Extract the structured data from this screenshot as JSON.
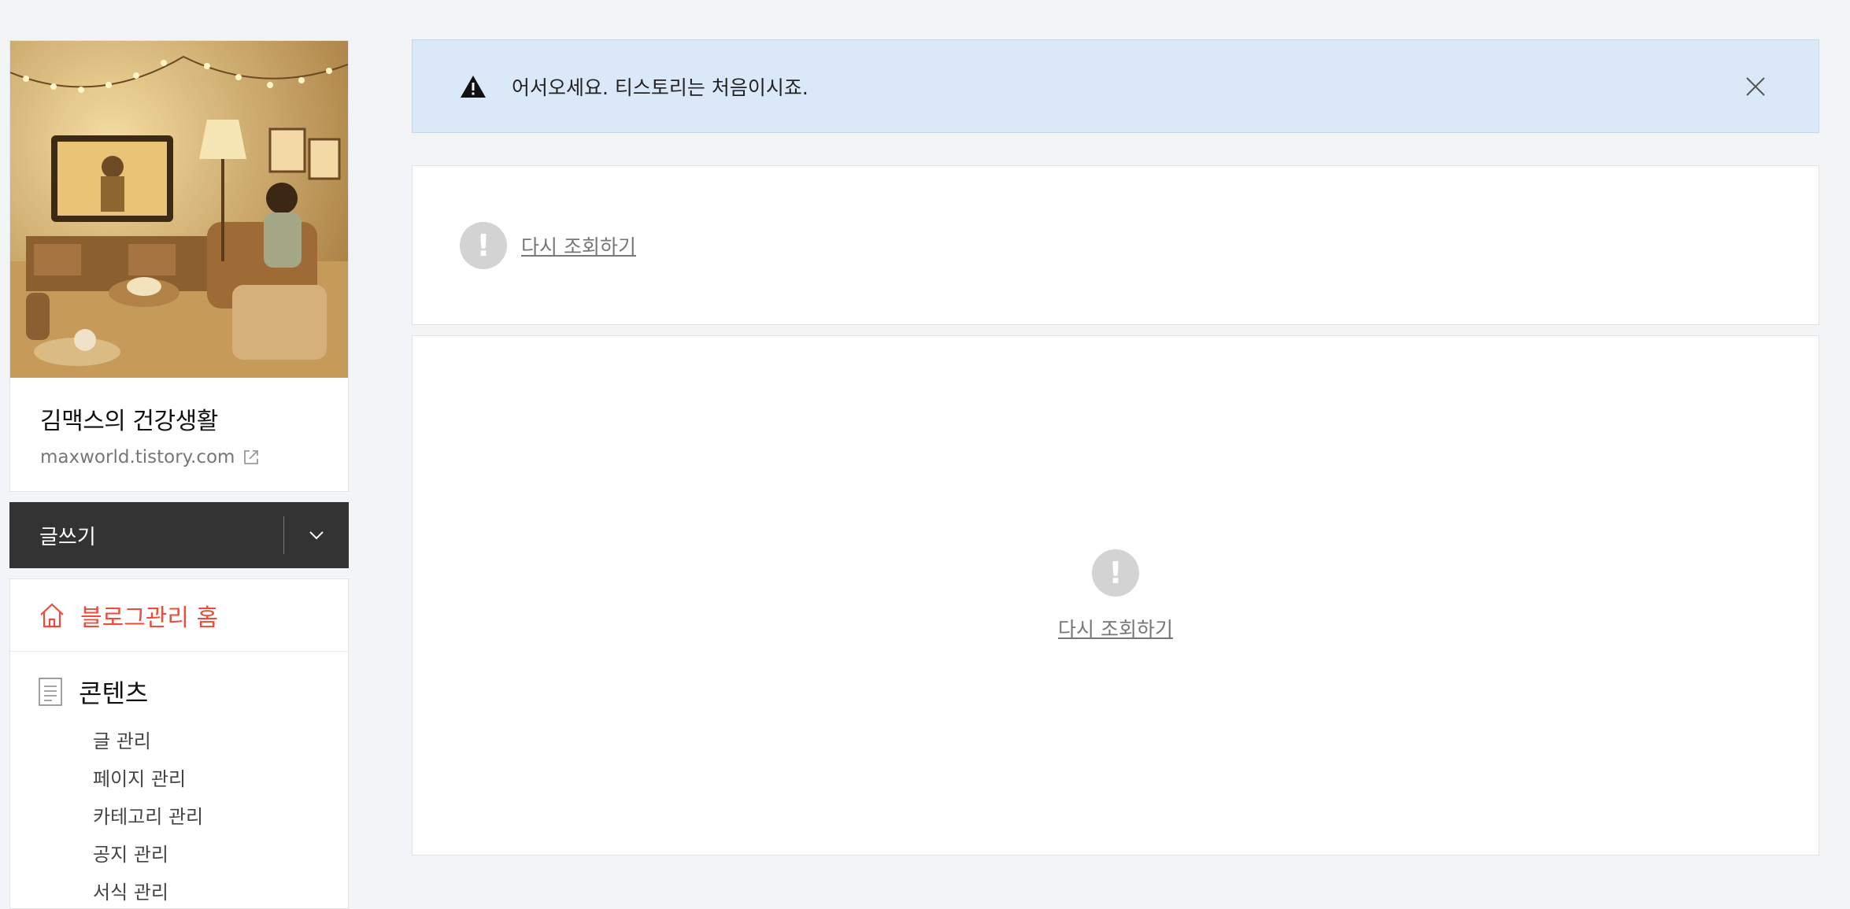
{
  "blog": {
    "title": "김맥스의 건강생활",
    "url": "maxworld.tistory.com"
  },
  "write_bar": {
    "label": "글쓰기"
  },
  "menu": {
    "home_label": "블로그관리 홈",
    "sections": [
      {
        "title": "콘텐츠",
        "items": [
          "글 관리",
          "페이지 관리",
          "카테고리 관리",
          "공지 관리",
          "서식 관리"
        ]
      }
    ]
  },
  "notice": {
    "text": "어서오세요. 티스토리는 처음이시죠."
  },
  "panels": {
    "retry_label_top": "다시 조회하기",
    "retry_label_main": "다시 조회하기"
  },
  "colors": {
    "accent_red": "#ef4b3b",
    "notice_bg": "#dbe8f7",
    "write_bar_bg": "#333333"
  },
  "icons": {
    "notice": "warning-triangle-icon",
    "close": "close-icon",
    "home": "home-icon",
    "contents": "document-icon",
    "external": "external-link-icon",
    "dropdown": "chevron-down-icon",
    "alert": "exclamation-circle-icon"
  }
}
